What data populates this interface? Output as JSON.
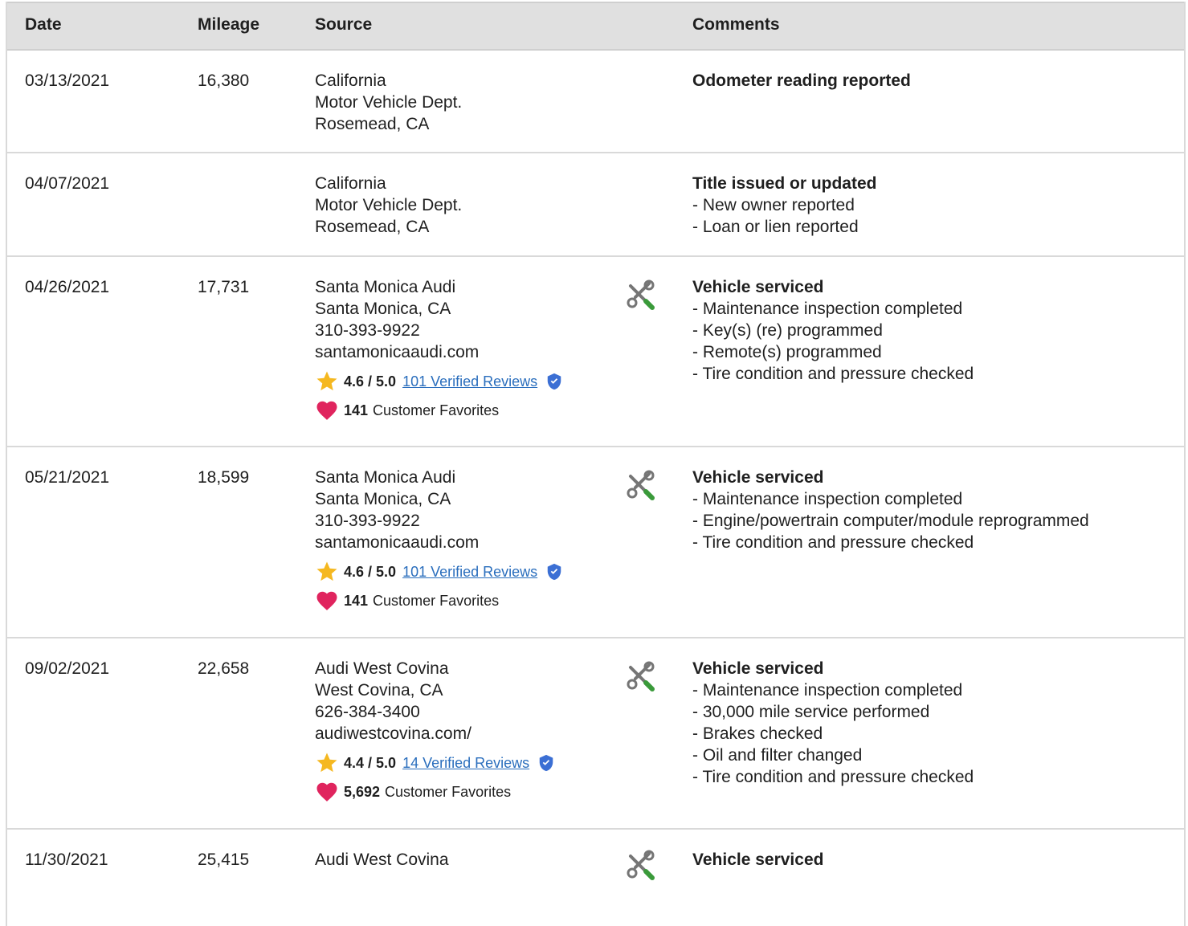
{
  "headers": {
    "date": "Date",
    "mileage": "Mileage",
    "source": "Source",
    "comments": "Comments"
  },
  "colors": {
    "accent_link": "#2a6ebd",
    "star": "#f5b820",
    "heart": "#e0245e",
    "tool_gray": "#757575",
    "tool_green": "#3a9a3a",
    "verified": "#3b6fd4"
  },
  "rows": [
    {
      "date": "03/13/2021",
      "mileage": "16,380",
      "source": [
        "California",
        "Motor Vehicle Dept.",
        "Rosemead, CA"
      ],
      "comment_title": "Odometer reading reported",
      "comments": []
    },
    {
      "date": "04/07/2021",
      "mileage": "",
      "source": [
        "California",
        "Motor Vehicle Dept.",
        "Rosemead, CA"
      ],
      "comment_title": "Title issued or updated",
      "comments": [
        "- New owner reported",
        "- Loan or lien reported"
      ]
    },
    {
      "date": "04/26/2021",
      "mileage": "17,731",
      "source": [
        "Santa Monica Audi",
        "Santa Monica, CA",
        "310-393-9922",
        "santamonicaaudi.com"
      ],
      "rating": "4.6 / 5.0",
      "reviews": "101 Verified Reviews",
      "favorites": "141",
      "favorites_label": "Customer Favorites",
      "service_icon": "service-tools-icon",
      "comment_title": "Vehicle serviced",
      "comments": [
        "- Maintenance inspection completed",
        "- Key(s) (re) programmed",
        "- Remote(s) programmed",
        "- Tire condition and pressure checked"
      ]
    },
    {
      "date": "05/21/2021",
      "mileage": "18,599",
      "source": [
        "Santa Monica Audi",
        "Santa Monica, CA",
        "310-393-9922",
        "santamonicaaudi.com"
      ],
      "rating": "4.6 / 5.0",
      "reviews": "101 Verified Reviews",
      "favorites": "141",
      "favorites_label": "Customer Favorites",
      "service_icon": "service-tools-icon",
      "comment_title": "Vehicle serviced",
      "comments": [
        "- Maintenance inspection completed",
        "- Engine/powertrain computer/module reprogrammed",
        "- Tire condition and pressure checked"
      ]
    },
    {
      "date": "09/02/2021",
      "mileage": "22,658",
      "source": [
        "Audi West Covina",
        "West Covina, CA",
        "626-384-3400",
        "audiwestcovina.com/"
      ],
      "rating": "4.4 / 5.0",
      "reviews": "14 Verified Reviews",
      "favorites": "5,692",
      "favorites_label": "Customer Favorites",
      "service_icon": "service-tools-icon",
      "comment_title": "Vehicle serviced",
      "comments": [
        "- Maintenance inspection completed",
        "- 30,000 mile service performed",
        "- Brakes checked",
        "- Oil and filter changed",
        "- Tire condition and pressure checked"
      ]
    },
    {
      "date": "11/30/2021",
      "mileage": "25,415",
      "source": [
        "Audi West Covina"
      ],
      "service_icon": "service-tools-icon",
      "comment_title": "Vehicle serviced",
      "comments": []
    }
  ]
}
